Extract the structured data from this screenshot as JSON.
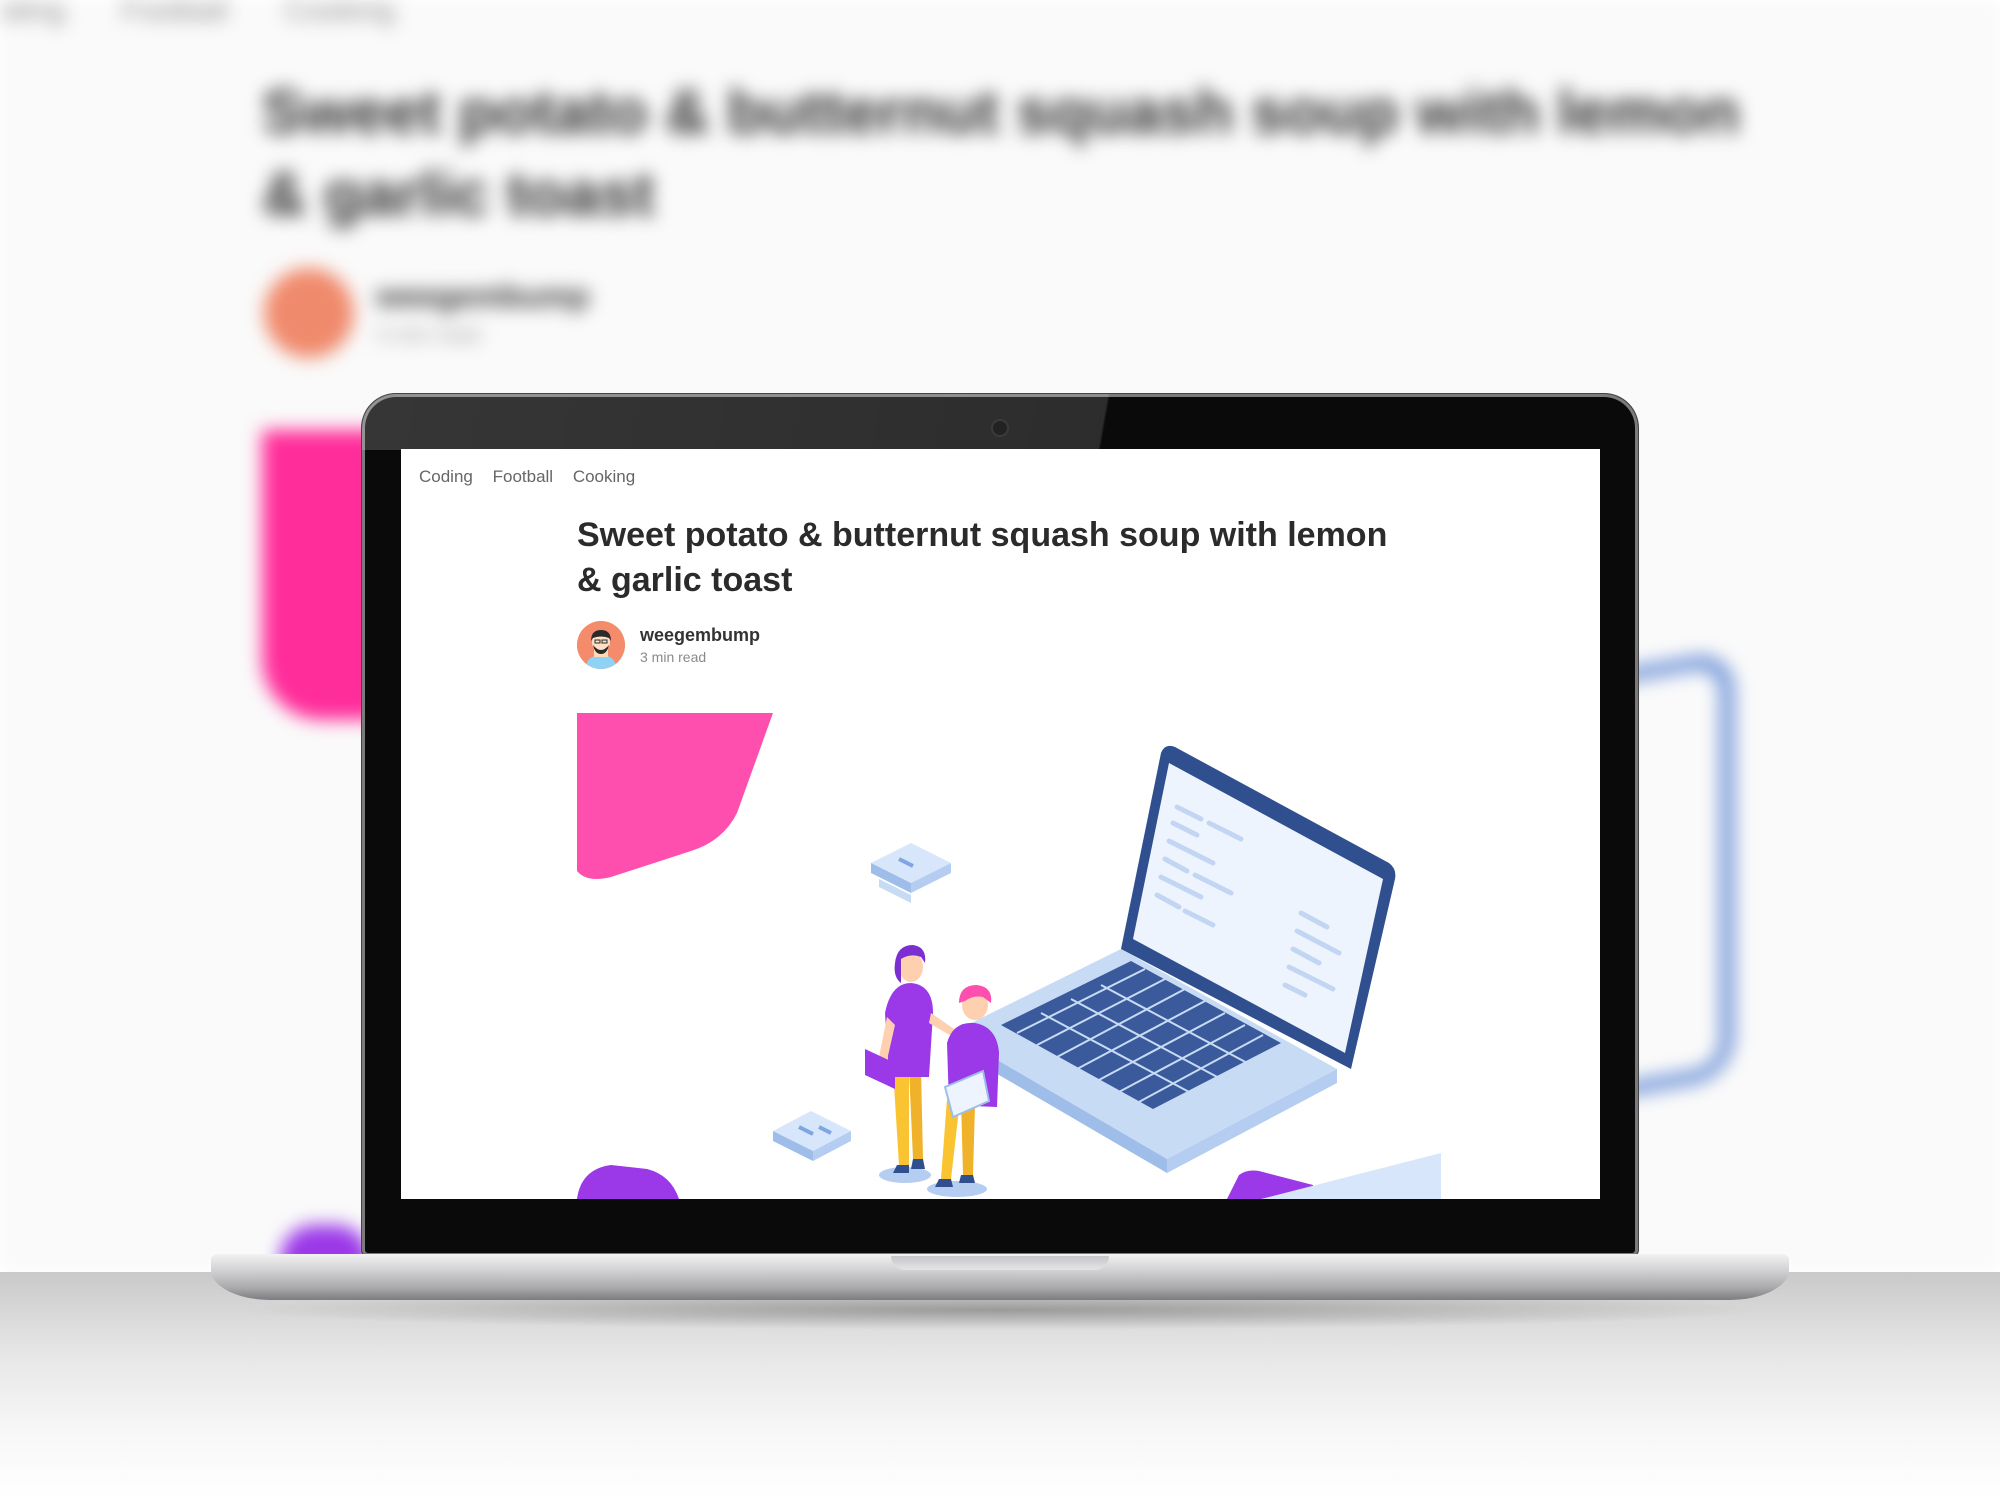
{
  "article": {
    "breadcrumbs": [
      "Coding",
      "Football",
      "Cooking"
    ],
    "title": "Sweet potato & butternut squash soup with lemon & garlic toast",
    "author": "weegembump",
    "read_time": "3 min read"
  },
  "colors": {
    "accent_pink": "#ff4fae",
    "accent_purple": "#9b38e8",
    "illustration_blue": "#2f4f8f",
    "illustration_light": "#d8e6fb"
  },
  "icons": [
    "avatar",
    "camera",
    "hero-illustration"
  ]
}
